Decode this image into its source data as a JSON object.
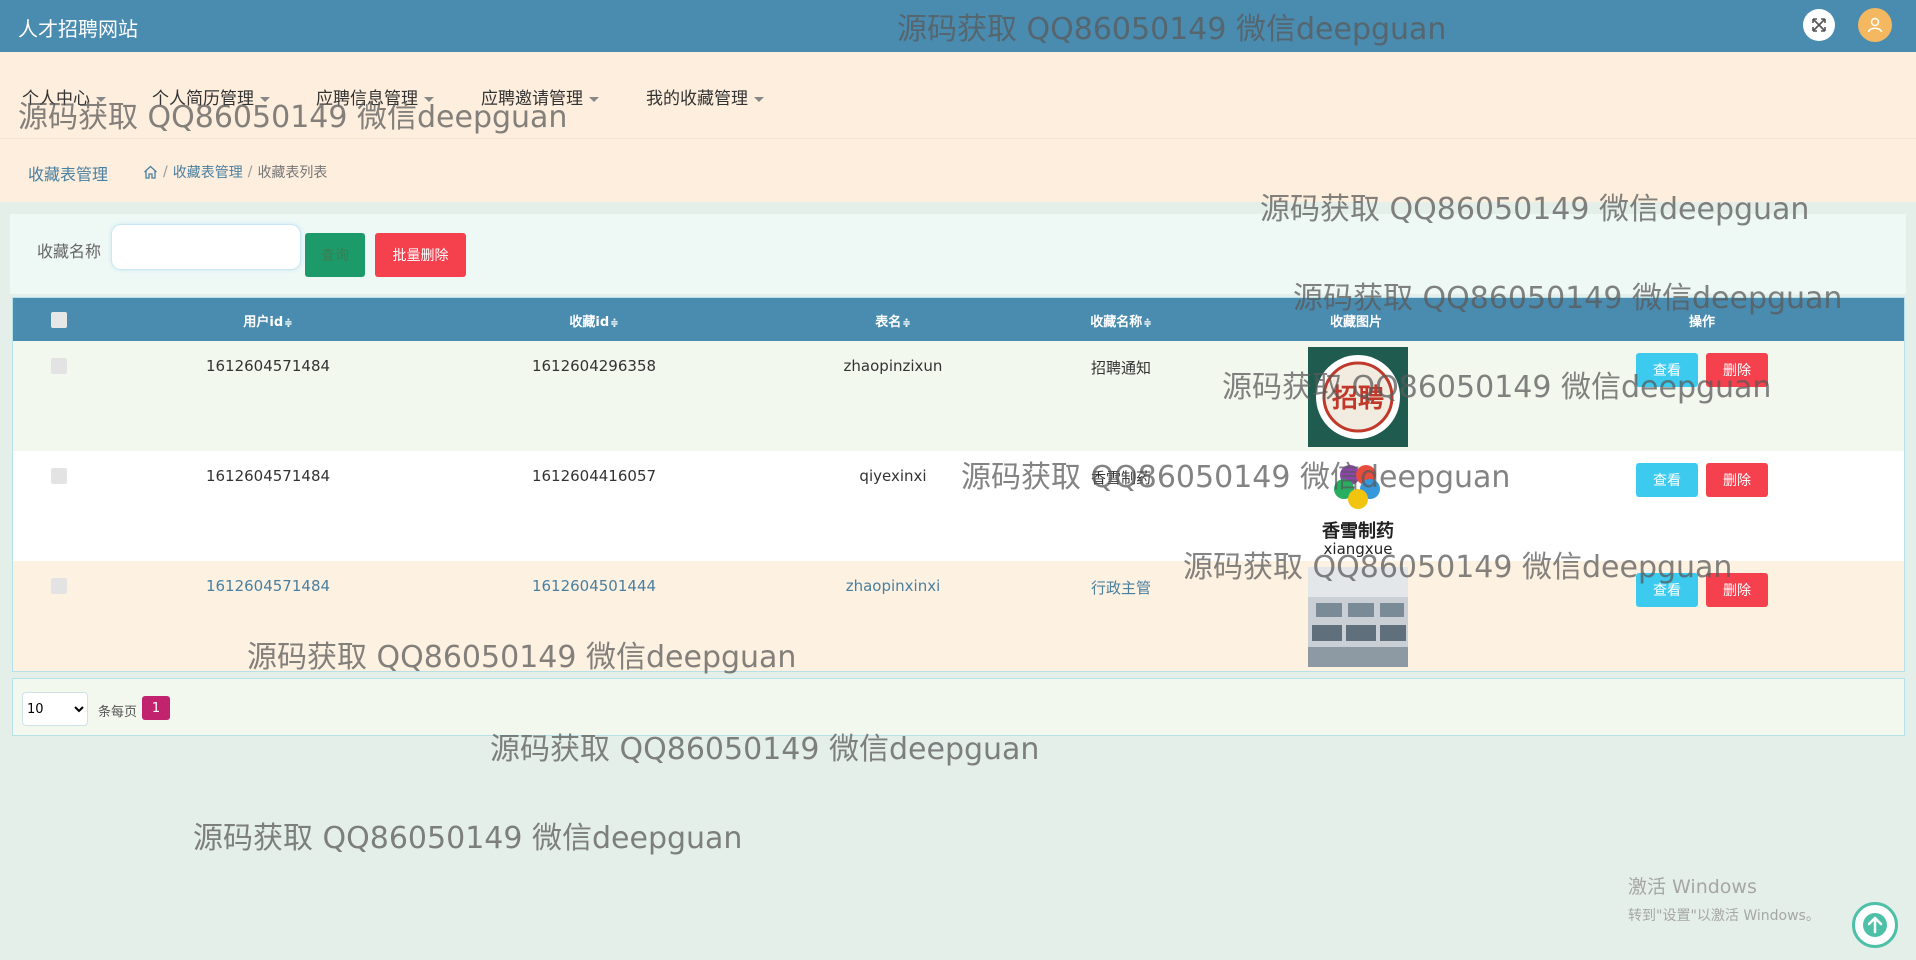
{
  "header": {
    "site_title": "人才招聘网站",
    "fullscreen_icon": "expand-icon",
    "avatar_icon": "user-icon"
  },
  "menu": [
    {
      "label": "个人中心"
    },
    {
      "label": "个人简历管理"
    },
    {
      "label": "应聘信息管理"
    },
    {
      "label": "应聘邀请管理"
    },
    {
      "label": "我的收藏管理"
    }
  ],
  "breadcrumb": {
    "title": "收藏表管理",
    "home_icon": "home-icon",
    "parent": "收藏表管理",
    "current": "收藏表列表"
  },
  "search": {
    "label": "收藏名称",
    "value": "",
    "query_button": "查询",
    "batch_delete_button": "批量删除"
  },
  "table": {
    "columns": [
      "用户id",
      "收藏id",
      "表名",
      "收藏名称",
      "收藏图片",
      "操作"
    ],
    "sort_icon": "≑",
    "rows": [
      {
        "user_id": "1612604571484",
        "fav_id": "1612604296358",
        "table_name": "zhaopinzixun",
        "fav_name": "招聘通知",
        "image": "zhaopin-logo"
      },
      {
        "user_id": "1612604571484",
        "fav_id": "1612604416057",
        "table_name": "qiyexinxi",
        "fav_name": "香雪制药",
        "image": "xiangxue-logo"
      },
      {
        "user_id": "1612604571484",
        "fav_id": "1612604501444",
        "table_name": "zhaopinxinxi",
        "fav_name": "行政主管",
        "image": "office-photo"
      }
    ],
    "view_button": "查看",
    "delete_button": "删除",
    "logo1_text": "招聘",
    "logo2_cn": "香雪制药",
    "logo2_en": "xiangxue"
  },
  "pagination": {
    "page_size": "10",
    "page_size_options": [
      "10"
    ],
    "per_page_label": "条每页",
    "current_page": "1"
  },
  "watermark": "源码获取 QQ86050149 微信deepguan",
  "windows": {
    "line1": "激活 Windows",
    "line2": "转到\"设置\"以激活 Windows。"
  },
  "colors": {
    "topbar": "#4a8bb0",
    "menu_bg": "#fdeedd",
    "view_button": "#3ccaef",
    "delete_button": "#f5404e",
    "query_button": "#1d9a6a",
    "page_active": "#c2236f"
  }
}
